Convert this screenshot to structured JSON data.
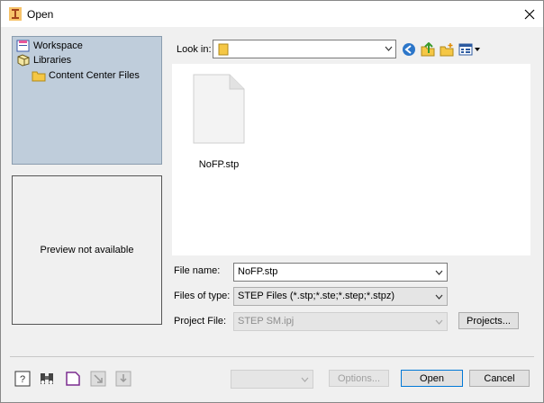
{
  "window": {
    "title": "Open",
    "close_icon": "close-icon"
  },
  "locations": [
    {
      "label": "Workspace",
      "icon": "workspace-icon"
    },
    {
      "label": "Libraries",
      "icon": "libraries-icon"
    },
    {
      "label": "Content Center Files",
      "icon": "folder-icon"
    }
  ],
  "preview": {
    "text": "Preview not available"
  },
  "lookin": {
    "label": "Look in:",
    "value": ""
  },
  "files": [
    {
      "name": "NoFP.stp",
      "icon": "document-icon"
    }
  ],
  "fields": {
    "file_name": {
      "label": "File name:",
      "value": "NoFP.stp"
    },
    "file_type": {
      "label": "Files of type:",
      "value": "STEP Files (*.stp;*.ste;*.step;*.stpz)"
    },
    "project": {
      "label": "Project File:",
      "value": "STEP SM.ipj"
    }
  },
  "buttons": {
    "projects": "Projects...",
    "options": "Options...",
    "open": "Open",
    "cancel": "Cancel"
  }
}
